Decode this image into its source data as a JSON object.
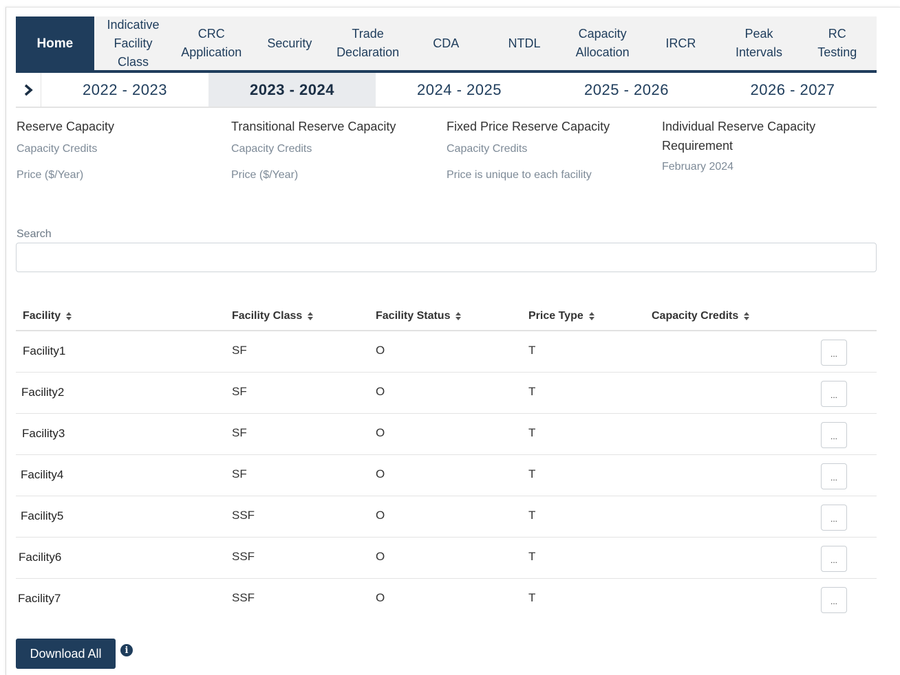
{
  "nav": {
    "items": [
      {
        "label": "Home"
      },
      {
        "label": "Indicative Facility Class"
      },
      {
        "label": "CRC Application"
      },
      {
        "label": "Security"
      },
      {
        "label": "Trade Declaration"
      },
      {
        "label": "CDA"
      },
      {
        "label": "NTDL"
      },
      {
        "label": "Capacity Allocation"
      },
      {
        "label": "IRCR"
      },
      {
        "label": "Peak Intervals"
      },
      {
        "label": "RC Testing"
      }
    ],
    "active": "Home"
  },
  "years": {
    "items": [
      "2022 - 2023",
      "2023 - 2024",
      "2024 - 2025",
      "2025 - 2026",
      "2026 - 2027"
    ],
    "active": "2023 - 2024",
    "arrow_icon": "chevron-right-icon"
  },
  "summary": [
    {
      "heading": "Reserve Capacity",
      "lines": [
        "Capacity Credits",
        "Price ($/Year)"
      ]
    },
    {
      "heading": "Transitional Reserve Capacity",
      "lines": [
        "Capacity Credits",
        "Price ($/Year)"
      ]
    },
    {
      "heading": "Fixed Price Reserve Capacity",
      "lines": [
        "Capacity Credits",
        "Price is unique to each facility"
      ]
    },
    {
      "heading": "Individual Reserve Capacity Requirement",
      "lines": [
        "February 2024"
      ]
    }
  ],
  "search": {
    "label": "Search",
    "value": "",
    "placeholder": ""
  },
  "table": {
    "headers": {
      "facility": "Facility",
      "facility_class": "Facility Class",
      "facility_status": "Facility Status",
      "price_type": "Price Type",
      "capacity_credits": "Capacity Credits"
    },
    "rows": [
      {
        "facility": "Facility1",
        "facility_class": "SF",
        "facility_status": "O",
        "price_type": "T",
        "capacity_credits": "",
        "action": "..."
      },
      {
        "facility": "Facility2",
        "facility_class": "SF",
        "facility_status": "O",
        "price_type": "T",
        "capacity_credits": "",
        "action": "..."
      },
      {
        "facility": "Facility3",
        "facility_class": "SF",
        "facility_status": "O",
        "price_type": "T",
        "capacity_credits": "",
        "action": "..."
      },
      {
        "facility": "Facility4",
        "facility_class": "SF",
        "facility_status": "O",
        "price_type": "T",
        "capacity_credits": "",
        "action": "..."
      },
      {
        "facility": "Facility5",
        "facility_class": "SSF",
        "facility_status": "O",
        "price_type": "T",
        "capacity_credits": "",
        "action": "..."
      },
      {
        "facility": "Facility6",
        "facility_class": "SSF",
        "facility_status": "O",
        "price_type": "T",
        "capacity_credits": "",
        "action": "..."
      },
      {
        "facility": "Facility7",
        "facility_class": "SSF",
        "facility_status": "O",
        "price_type": "T",
        "capacity_credits": "",
        "action": "..."
      }
    ]
  },
  "footer": {
    "download_label": "Download All",
    "info_icon": "info-icon",
    "info_glyph": "i"
  },
  "colors": {
    "primary": "#1f3d5c",
    "nav_bg": "#f2f2f2",
    "active_year_bg": "#e9ebee"
  }
}
